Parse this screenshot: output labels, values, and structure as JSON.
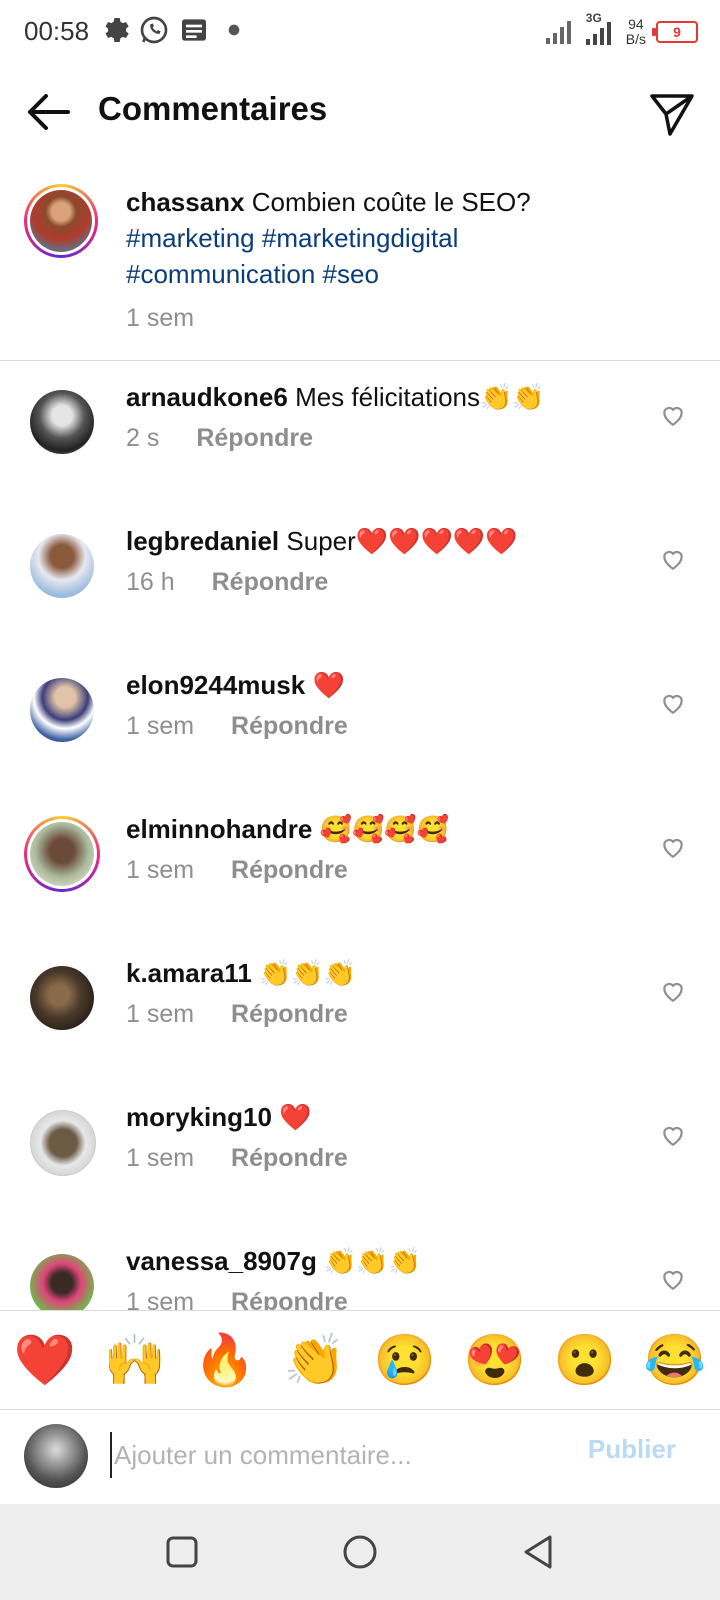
{
  "status_bar": {
    "time": "00:58",
    "net_speed_value": "94",
    "net_speed_unit": "B/s",
    "network_type": "3G",
    "battery_level": "9",
    "icons": [
      "gear-icon",
      "whatsapp-icon",
      "message-icon",
      "dot-icon",
      "signal-icon",
      "signal-3g-icon",
      "battery-icon"
    ]
  },
  "header": {
    "title": "Commentaires",
    "back_icon": "arrow-left-icon",
    "share_icon": "send-icon"
  },
  "caption": {
    "username": "chassanx",
    "text": "Combien coûte le SEO?",
    "hashtags": [
      "#marketing",
      "#marketingdigital",
      "#communication",
      "#seo"
    ],
    "time": "1 sem"
  },
  "comments": [
    {
      "username": "arnaudkone6",
      "text": "Mes félicitations👏👏",
      "time": "2 s",
      "reply": "Répondre"
    },
    {
      "username": "legbredaniel",
      "text": "Super❤️❤️❤️❤️❤️",
      "time": "16 h",
      "reply": "Répondre"
    },
    {
      "username": "elon9244musk",
      "text": "❤️",
      "time": "1 sem",
      "reply": "Répondre"
    },
    {
      "username": "elminnohandre",
      "text": "🥰🥰🥰🥰",
      "time": "1 sem",
      "reply": "Répondre"
    },
    {
      "username": "k.amara11",
      "text": "👏👏👏",
      "time": "1 sem",
      "reply": "Répondre"
    },
    {
      "username": "moryking10",
      "text": "❤️",
      "time": "1 sem",
      "reply": "Répondre"
    },
    {
      "username": "vanessa_8907g",
      "text": "👏👏👏",
      "time": "1 sem",
      "reply": "Répondre"
    }
  ],
  "emoji_bar": [
    "❤️",
    "🙌",
    "🔥",
    "👏",
    "😢",
    "😍",
    "😮",
    "😂"
  ],
  "input": {
    "placeholder": "Ajouter un commentaire...",
    "publish_label": "Publier"
  },
  "colors": {
    "hashtag": "#0a3d7a",
    "meta_gray": "#8e8e8e",
    "publish_disabled": "#b9d9f5",
    "battery_low": "#e53935"
  }
}
